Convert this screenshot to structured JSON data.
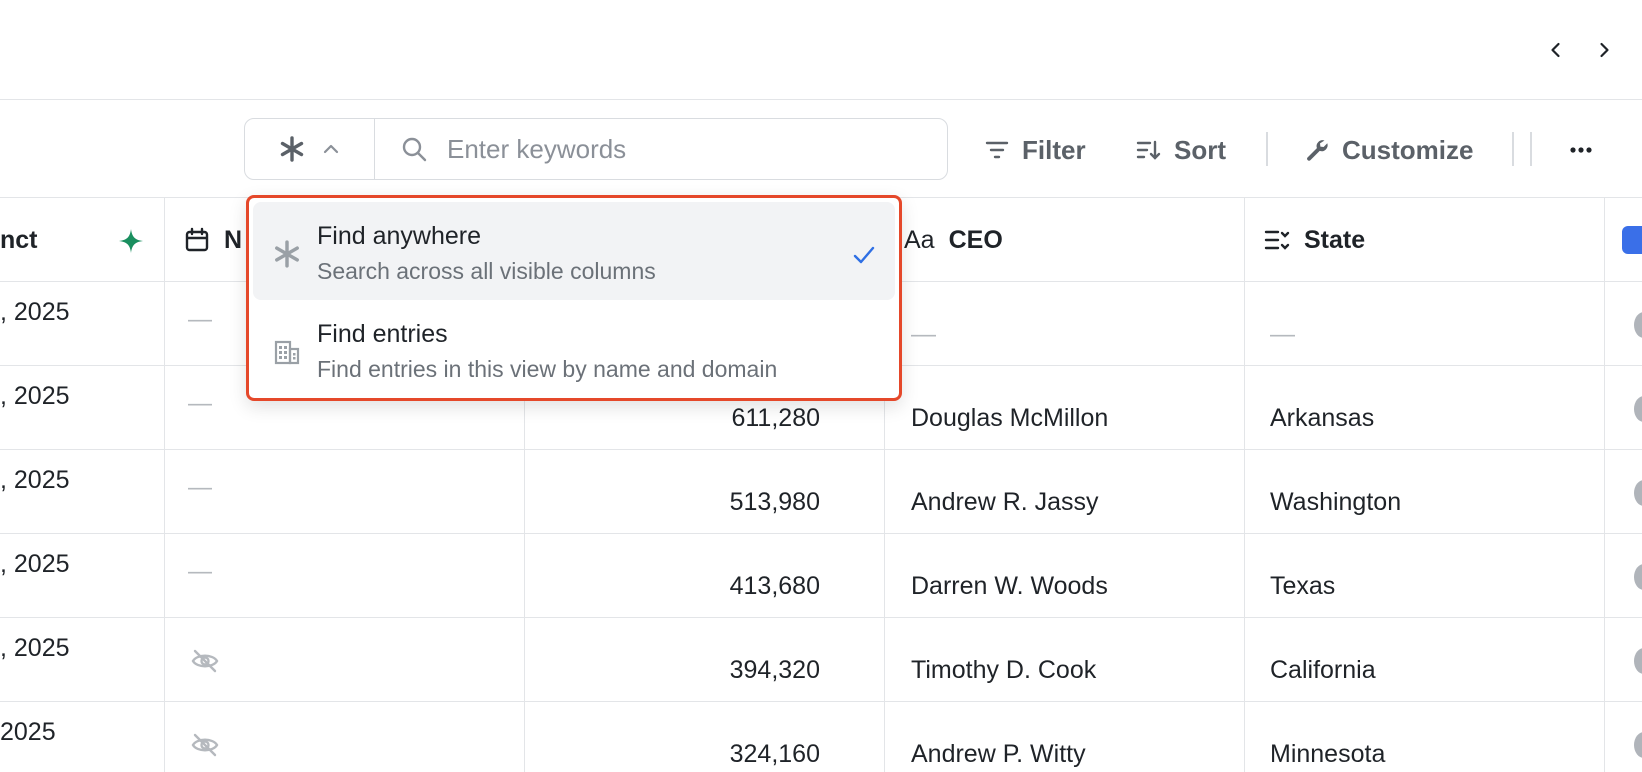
{
  "nav": {
    "prev_icon": "chevron-left-icon",
    "next_icon": "chevron-right-icon"
  },
  "search": {
    "mode_icon": "asterisk-icon",
    "placeholder": "Enter keywords"
  },
  "toolbar": {
    "filter_label": "Filter",
    "sort_label": "Sort",
    "customize_label": "Customize",
    "more_icon": "more-icon"
  },
  "table": {
    "headers": {
      "col1_partial": "nct",
      "col2_partial": "N",
      "ceo": "CEO",
      "ceo_type": "Aa",
      "state": "State"
    },
    "rows": [
      {
        "date": ", 2025",
        "employees_hidden": false,
        "revenue": "",
        "ceo": "—",
        "state": "—"
      },
      {
        "date": ", 2025",
        "employees_hidden": false,
        "revenue": "611,280",
        "ceo": "Douglas McMillon",
        "state": "Arkansas"
      },
      {
        "date": ", 2025",
        "employees_hidden": false,
        "revenue": "513,980",
        "ceo": "Andrew R. Jassy",
        "state": "Washington"
      },
      {
        "date": ", 2025",
        "employees_hidden": false,
        "revenue": "413,680",
        "ceo": "Darren W. Woods",
        "state": "Texas"
      },
      {
        "date": ", 2025",
        "employees_hidden": true,
        "revenue": "394,320",
        "ceo": "Timothy D. Cook",
        "state": "California"
      },
      {
        "date": " 2025",
        "employees_hidden": true,
        "revenue": "324,160",
        "ceo": "Andrew P. Witty",
        "state": "Minnesota"
      }
    ]
  },
  "dropdown": {
    "options": [
      {
        "title": "Find anywhere",
        "description": "Search across all visible columns",
        "icon": "asterisk-icon",
        "selected": true
      },
      {
        "title": "Find entries",
        "description": "Find entries in this view by name and domain",
        "icon": "building-icon",
        "selected": false
      }
    ]
  },
  "colors": {
    "accent_red": "#e5482a",
    "check_blue": "#2f6fe4",
    "sparkle_green": "#1a8f5f",
    "link_blue": "#3a6fe8"
  }
}
